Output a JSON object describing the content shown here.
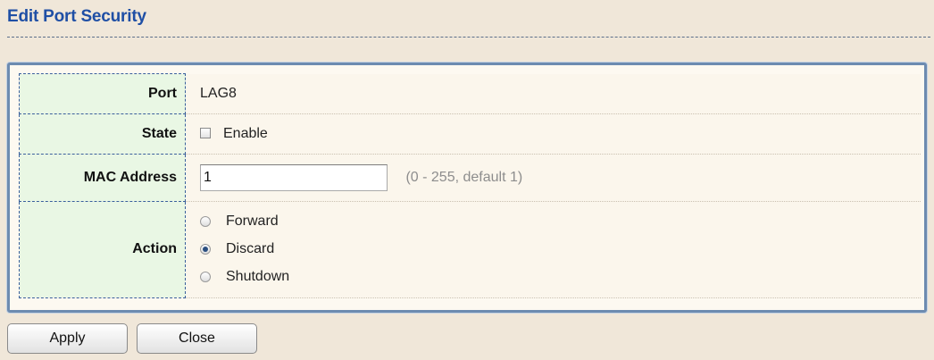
{
  "page": {
    "title": "Edit Port Security"
  },
  "form": {
    "port": {
      "label": "Port",
      "value": "LAG8"
    },
    "state": {
      "label": "State",
      "option_label": "Enable",
      "checked": false
    },
    "mac_address": {
      "label": "MAC Address",
      "value": "1",
      "hint": "(0 - 255, default 1)"
    },
    "action": {
      "label": "Action",
      "options": [
        "Forward",
        "Discard",
        "Shutdown"
      ],
      "selected": "Discard"
    }
  },
  "buttons": {
    "apply": "Apply",
    "close": "Close"
  },
  "colors": {
    "title": "#1f4fa5",
    "label_bg": "#e9f7e4",
    "panel_border": "#6d8bb0"
  }
}
